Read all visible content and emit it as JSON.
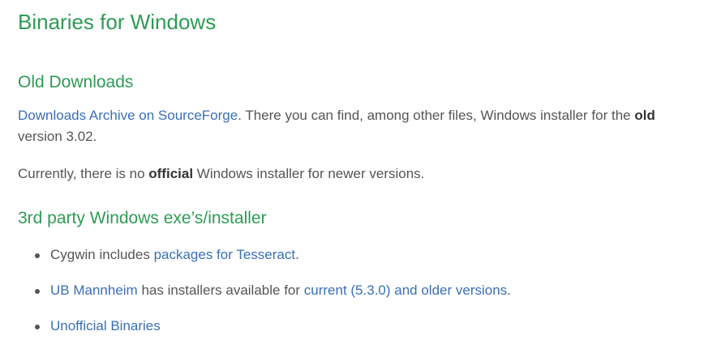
{
  "page_title": "Binaries for Windows",
  "old_downloads": {
    "heading": "Old Downloads",
    "p1": {
      "link": "Downloads Archive on SourceForge",
      "text_a": ". There you can find, among other files, Windows installer for the ",
      "bold": "old",
      "text_b": " version 3.02."
    },
    "p2": {
      "text_a": "Currently, there is no ",
      "bold": "official",
      "text_b": " Windows installer for newer versions."
    }
  },
  "third_party": {
    "heading": "3rd party Windows exe’s/installer",
    "items": [
      {
        "text_a": "Cygwin includes ",
        "link": "packages for Tesseract",
        "text_b": "."
      },
      {
        "link_a": "UB Mannheim",
        "text_a": " has installers available for ",
        "link_b": "current (5.3.0) and older versions",
        "text_b": "."
      },
      {
        "link": "Unofficial Binaries"
      }
    ]
  },
  "colors": {
    "heading_green": "#2e9b55",
    "link_blue": "#3a6fb8",
    "text_gray": "#555555"
  }
}
